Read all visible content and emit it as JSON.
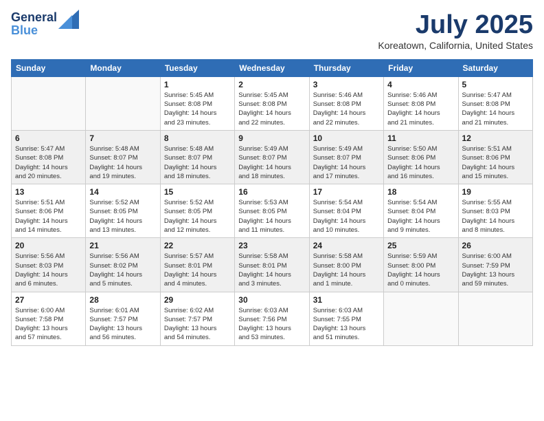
{
  "header": {
    "logo_line1": "General",
    "logo_line2": "Blue",
    "month_title": "July 2025",
    "subtitle": "Koreatown, California, United States"
  },
  "weekdays": [
    "Sunday",
    "Monday",
    "Tuesday",
    "Wednesday",
    "Thursday",
    "Friday",
    "Saturday"
  ],
  "weeks": [
    [
      {
        "day": "",
        "info": ""
      },
      {
        "day": "",
        "info": ""
      },
      {
        "day": "1",
        "info": "Sunrise: 5:45 AM\nSunset: 8:08 PM\nDaylight: 14 hours\nand 23 minutes."
      },
      {
        "day": "2",
        "info": "Sunrise: 5:45 AM\nSunset: 8:08 PM\nDaylight: 14 hours\nand 22 minutes."
      },
      {
        "day": "3",
        "info": "Sunrise: 5:46 AM\nSunset: 8:08 PM\nDaylight: 14 hours\nand 22 minutes."
      },
      {
        "day": "4",
        "info": "Sunrise: 5:46 AM\nSunset: 8:08 PM\nDaylight: 14 hours\nand 21 minutes."
      },
      {
        "day": "5",
        "info": "Sunrise: 5:47 AM\nSunset: 8:08 PM\nDaylight: 14 hours\nand 21 minutes."
      }
    ],
    [
      {
        "day": "6",
        "info": "Sunrise: 5:47 AM\nSunset: 8:08 PM\nDaylight: 14 hours\nand 20 minutes."
      },
      {
        "day": "7",
        "info": "Sunrise: 5:48 AM\nSunset: 8:07 PM\nDaylight: 14 hours\nand 19 minutes."
      },
      {
        "day": "8",
        "info": "Sunrise: 5:48 AM\nSunset: 8:07 PM\nDaylight: 14 hours\nand 18 minutes."
      },
      {
        "day": "9",
        "info": "Sunrise: 5:49 AM\nSunset: 8:07 PM\nDaylight: 14 hours\nand 18 minutes."
      },
      {
        "day": "10",
        "info": "Sunrise: 5:49 AM\nSunset: 8:07 PM\nDaylight: 14 hours\nand 17 minutes."
      },
      {
        "day": "11",
        "info": "Sunrise: 5:50 AM\nSunset: 8:06 PM\nDaylight: 14 hours\nand 16 minutes."
      },
      {
        "day": "12",
        "info": "Sunrise: 5:51 AM\nSunset: 8:06 PM\nDaylight: 14 hours\nand 15 minutes."
      }
    ],
    [
      {
        "day": "13",
        "info": "Sunrise: 5:51 AM\nSunset: 8:06 PM\nDaylight: 14 hours\nand 14 minutes."
      },
      {
        "day": "14",
        "info": "Sunrise: 5:52 AM\nSunset: 8:05 PM\nDaylight: 14 hours\nand 13 minutes."
      },
      {
        "day": "15",
        "info": "Sunrise: 5:52 AM\nSunset: 8:05 PM\nDaylight: 14 hours\nand 12 minutes."
      },
      {
        "day": "16",
        "info": "Sunrise: 5:53 AM\nSunset: 8:05 PM\nDaylight: 14 hours\nand 11 minutes."
      },
      {
        "day": "17",
        "info": "Sunrise: 5:54 AM\nSunset: 8:04 PM\nDaylight: 14 hours\nand 10 minutes."
      },
      {
        "day": "18",
        "info": "Sunrise: 5:54 AM\nSunset: 8:04 PM\nDaylight: 14 hours\nand 9 minutes."
      },
      {
        "day": "19",
        "info": "Sunrise: 5:55 AM\nSunset: 8:03 PM\nDaylight: 14 hours\nand 8 minutes."
      }
    ],
    [
      {
        "day": "20",
        "info": "Sunrise: 5:56 AM\nSunset: 8:03 PM\nDaylight: 14 hours\nand 6 minutes."
      },
      {
        "day": "21",
        "info": "Sunrise: 5:56 AM\nSunset: 8:02 PM\nDaylight: 14 hours\nand 5 minutes."
      },
      {
        "day": "22",
        "info": "Sunrise: 5:57 AM\nSunset: 8:01 PM\nDaylight: 14 hours\nand 4 minutes."
      },
      {
        "day": "23",
        "info": "Sunrise: 5:58 AM\nSunset: 8:01 PM\nDaylight: 14 hours\nand 3 minutes."
      },
      {
        "day": "24",
        "info": "Sunrise: 5:58 AM\nSunset: 8:00 PM\nDaylight: 14 hours\nand 1 minute."
      },
      {
        "day": "25",
        "info": "Sunrise: 5:59 AM\nSunset: 8:00 PM\nDaylight: 14 hours\nand 0 minutes."
      },
      {
        "day": "26",
        "info": "Sunrise: 6:00 AM\nSunset: 7:59 PM\nDaylight: 13 hours\nand 59 minutes."
      }
    ],
    [
      {
        "day": "27",
        "info": "Sunrise: 6:00 AM\nSunset: 7:58 PM\nDaylight: 13 hours\nand 57 minutes."
      },
      {
        "day": "28",
        "info": "Sunrise: 6:01 AM\nSunset: 7:57 PM\nDaylight: 13 hours\nand 56 minutes."
      },
      {
        "day": "29",
        "info": "Sunrise: 6:02 AM\nSunset: 7:57 PM\nDaylight: 13 hours\nand 54 minutes."
      },
      {
        "day": "30",
        "info": "Sunrise: 6:03 AM\nSunset: 7:56 PM\nDaylight: 13 hours\nand 53 minutes."
      },
      {
        "day": "31",
        "info": "Sunrise: 6:03 AM\nSunset: 7:55 PM\nDaylight: 13 hours\nand 51 minutes."
      },
      {
        "day": "",
        "info": ""
      },
      {
        "day": "",
        "info": ""
      }
    ]
  ]
}
